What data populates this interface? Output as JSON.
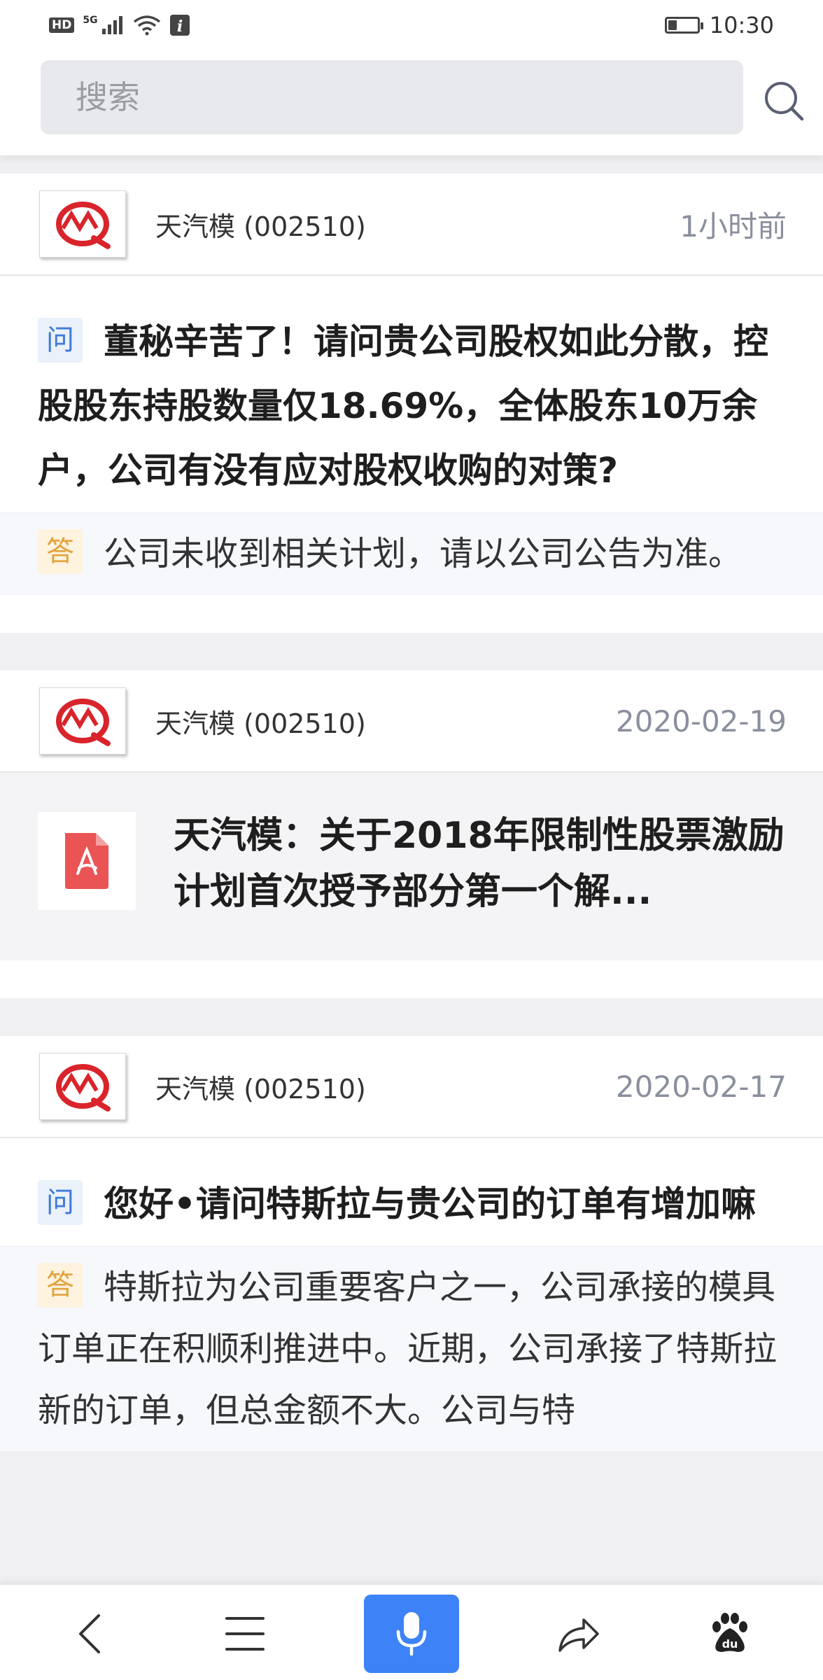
{
  "status_bar": {
    "hd": "HD",
    "network": "5G",
    "time": "10:30",
    "battery_level": 0.3
  },
  "search": {
    "placeholder": "搜索"
  },
  "cards": [
    {
      "company": "天汽模 (002510)",
      "time": "1小时前",
      "question_tag": "问",
      "question": "董秘辛苦了！请问贵公司股权如此分散，控股股东持股数量仅18.69%，全体股东10万余户，公司有没有应对股权收购的对策?",
      "answer_tag": "答",
      "answer": "公司未收到相关计划，请以公司公告为准。"
    },
    {
      "company": "天汽模 (002510)",
      "time": "2020-02-19",
      "doc_title": "天汽模：关于2018年限制性股票激励计划首次授予部分第一个解..."
    },
    {
      "company": "天汽模 (002510)",
      "time": "2020-02-17",
      "question_tag": "问",
      "question": "您好•请问特斯拉与贵公司的订单有增加嘛",
      "answer_tag": "答",
      "answer": "特斯拉为公司重要客户之一，公司承接的模具订单正在积顺利推进中。近期，公司承接了特斯拉新的订单，但总金额不大。公司与特"
    }
  ],
  "colors": {
    "accent": "#3d82f6",
    "question_tag": "#3f7ad9",
    "answer_tag": "#e3a33c",
    "time_text": "#8a8f9d",
    "logo_red": "#d9242b",
    "pdf_red": "#ea5455"
  },
  "icons": {
    "search": "search-icon",
    "back": "back-icon",
    "menu": "menu-icon",
    "mic": "microphone-icon",
    "share": "share-icon",
    "baidu": "baidu-paw-icon",
    "pdf": "pdf-icon"
  }
}
